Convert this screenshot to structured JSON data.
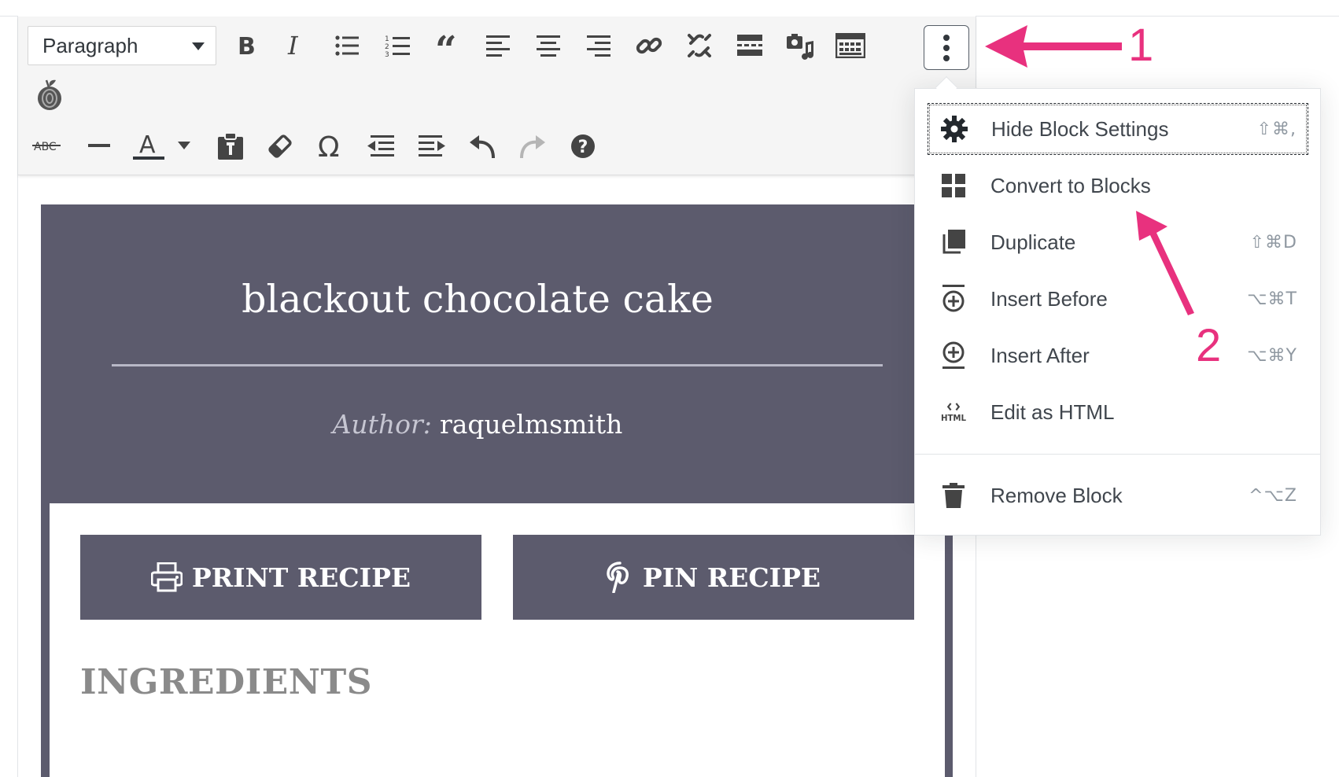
{
  "toolbar": {
    "format_select": "Paragraph",
    "icons_row1": [
      "bold-icon",
      "italic-icon",
      "bullet-list-icon",
      "numbered-list-icon",
      "blockquote-icon",
      "align-left-icon",
      "align-center-icon",
      "align-right-icon",
      "link-icon",
      "unlink-icon",
      "read-more-icon",
      "media-icon",
      "toolbar-toggle-icon"
    ],
    "icons_row2": [
      "strikethrough-icon",
      "horizontal-line-icon",
      "text-color-icon",
      "paste-text-icon",
      "clear-formatting-icon",
      "special-character-icon",
      "outdent-icon",
      "indent-icon",
      "undo-icon",
      "redo-icon",
      "help-icon"
    ],
    "strikethrough_text": "ABC",
    "text_color_letter": "A",
    "more_button": "more-options-icon"
  },
  "recipe": {
    "title": "blackout chocolate cake",
    "author_label": "Author:",
    "author_name": "raquelmsmith",
    "print_button": "PRINT RECIPE",
    "pin_button": "PIN RECIPE",
    "ingredients_heading": "INGREDIENTS",
    "card_color": "#5c5b6d"
  },
  "menu": {
    "items": [
      {
        "label": "Hide Block Settings",
        "shortcut": "⇧⌘,",
        "icon": "gear-icon"
      },
      {
        "label": "Convert to Blocks",
        "shortcut": "",
        "icon": "blocks-grid-icon"
      },
      {
        "label": "Duplicate",
        "shortcut": "⇧⌘D",
        "icon": "duplicate-icon"
      },
      {
        "label": "Insert Before",
        "shortcut": "⌥⌘T",
        "icon": "insert-before-icon"
      },
      {
        "label": "Insert After",
        "shortcut": "⌥⌘Y",
        "icon": "insert-after-icon"
      },
      {
        "label": "Edit as HTML",
        "shortcut": "",
        "icon": "html-icon"
      },
      {
        "label": "Remove Block",
        "shortcut": "^⌥Z",
        "icon": "trash-icon"
      }
    ],
    "html_icon_text": "HTML"
  },
  "annotations": {
    "step1": "1",
    "step2": "2",
    "color": "#e8317e"
  }
}
